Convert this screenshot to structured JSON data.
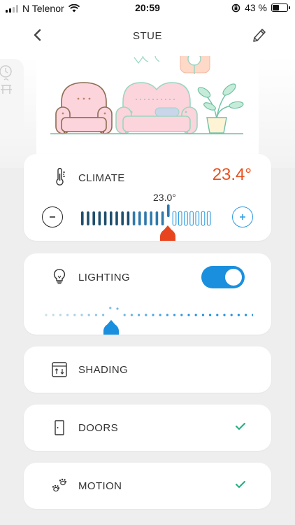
{
  "status_bar": {
    "carrier": "N Telenor",
    "time": "20:59",
    "battery_text": "43 %",
    "battery_level": 0.43
  },
  "header": {
    "title": "STUE"
  },
  "climate": {
    "label": "CLIMATE",
    "current_temp": "23.4°",
    "setpoint": "23.0°",
    "accent": "#e8501f"
  },
  "lighting": {
    "label": "LIGHTING",
    "enabled": true,
    "accent": "#1a8fde"
  },
  "shading": {
    "label": "SHADING"
  },
  "doors": {
    "label": "DOORS",
    "status_icon": "check-icon"
  },
  "motion": {
    "label": "MOTION",
    "status_icon": "check-icon"
  },
  "colors": {
    "check": "#1fae7c",
    "climate_dark": "#1f4e6d",
    "light_blue": "#2d9be0"
  }
}
